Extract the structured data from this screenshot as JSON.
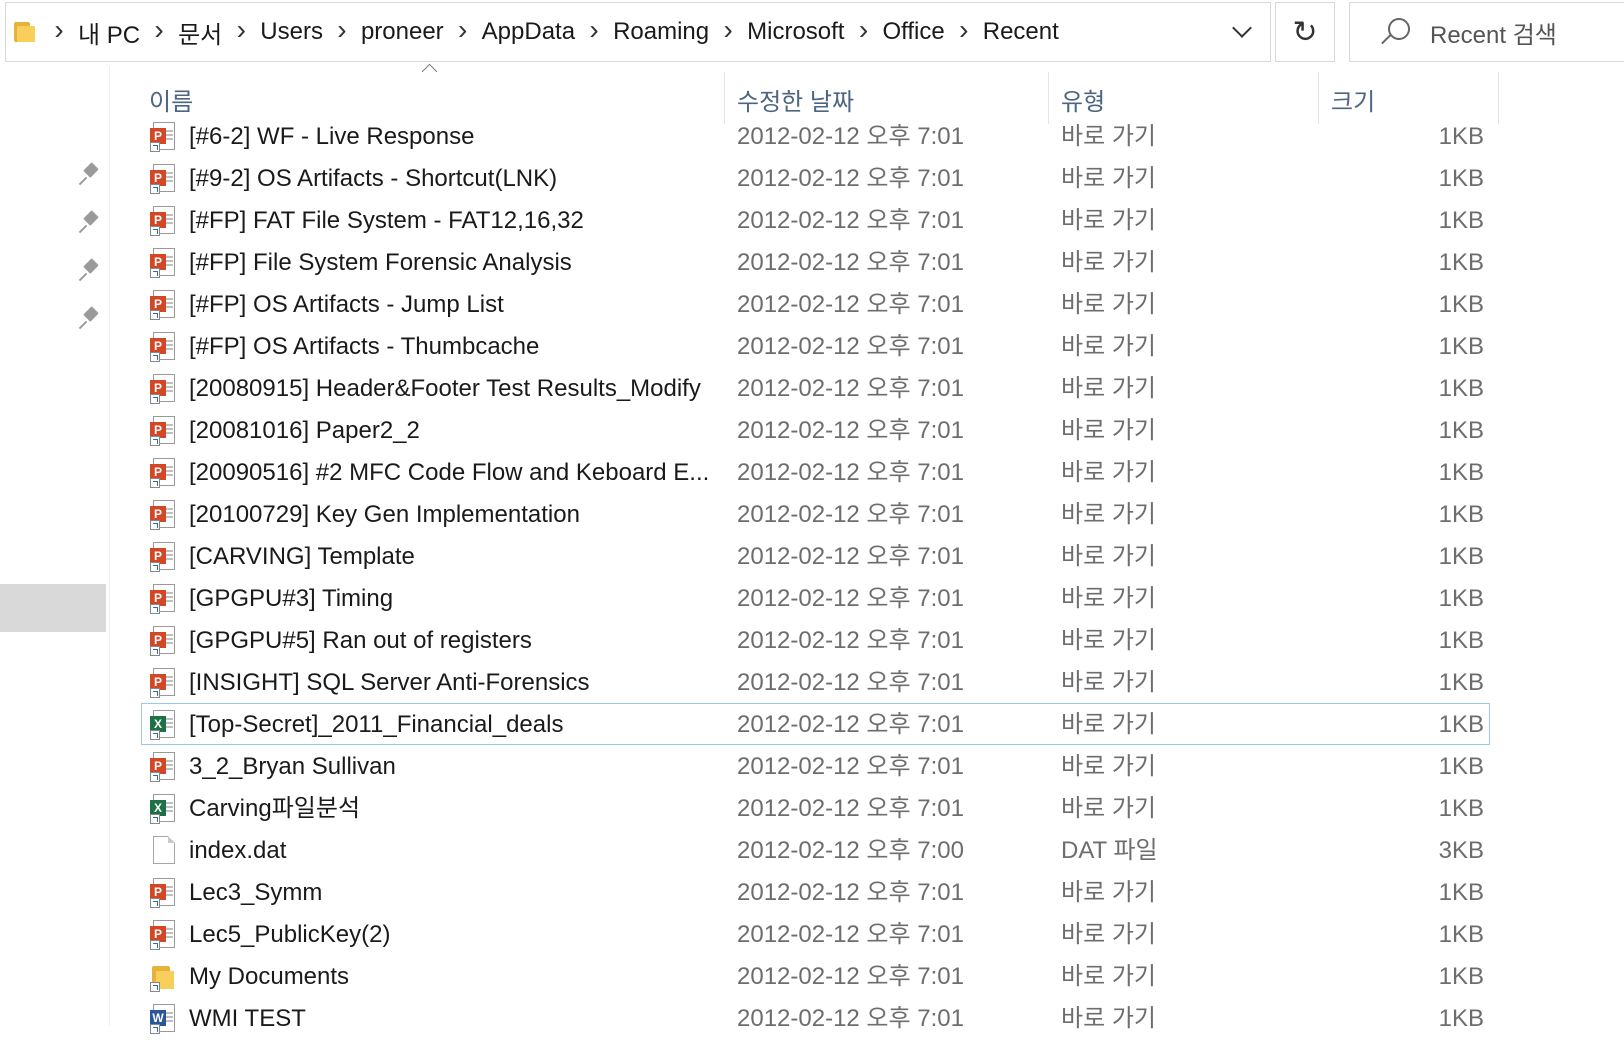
{
  "address_bar": {
    "breadcrumbs": [
      "내 PC",
      "문서",
      "Users",
      "proneer",
      "AppData",
      "Roaming",
      "Microsoft",
      "Office",
      "Recent"
    ]
  },
  "search": {
    "placeholder": "Recent 검색"
  },
  "columns": {
    "name": "이름",
    "date": "수정한 날짜",
    "type": "유형",
    "size": "크기"
  },
  "files": [
    {
      "name": "[#6-2] WF - Live Response",
      "date": "2012-02-12 오후 7:01",
      "type": "바로 가기",
      "size": "1KB",
      "icon": "powerpoint-shortcut-icon"
    },
    {
      "name": "[#9-2] OS Artifacts - Shortcut(LNK)",
      "date": "2012-02-12 오후 7:01",
      "type": "바로 가기",
      "size": "1KB",
      "icon": "powerpoint-shortcut-icon"
    },
    {
      "name": "[#FP] FAT File System - FAT12,16,32",
      "date": "2012-02-12 오후 7:01",
      "type": "바로 가기",
      "size": "1KB",
      "icon": "powerpoint-shortcut-icon"
    },
    {
      "name": "[#FP] File System Forensic Analysis",
      "date": "2012-02-12 오후 7:01",
      "type": "바로 가기",
      "size": "1KB",
      "icon": "powerpoint-shortcut-icon"
    },
    {
      "name": "[#FP] OS Artifacts - Jump List",
      "date": "2012-02-12 오후 7:01",
      "type": "바로 가기",
      "size": "1KB",
      "icon": "powerpoint-shortcut-icon"
    },
    {
      "name": "[#FP] OS Artifacts - Thumbcache",
      "date": "2012-02-12 오후 7:01",
      "type": "바로 가기",
      "size": "1KB",
      "icon": "powerpoint-shortcut-icon"
    },
    {
      "name": "[20080915] Header&Footer Test Results_Modify",
      "date": "2012-02-12 오후 7:01",
      "type": "바로 가기",
      "size": "1KB",
      "icon": "powerpoint-shortcut-icon"
    },
    {
      "name": "[20081016] Paper2_2",
      "date": "2012-02-12 오후 7:01",
      "type": "바로 가기",
      "size": "1KB",
      "icon": "powerpoint-shortcut-icon"
    },
    {
      "name": "[20090516] #2 MFC Code Flow and Keboard E...",
      "date": "2012-02-12 오후 7:01",
      "type": "바로 가기",
      "size": "1KB",
      "icon": "powerpoint-shortcut-icon"
    },
    {
      "name": "[20100729] Key Gen Implementation",
      "date": "2012-02-12 오후 7:01",
      "type": "바로 가기",
      "size": "1KB",
      "icon": "powerpoint-shortcut-icon"
    },
    {
      "name": "[CARVING] Template",
      "date": "2012-02-12 오후 7:01",
      "type": "바로 가기",
      "size": "1KB",
      "icon": "powerpoint-shortcut-icon"
    },
    {
      "name": "[GPGPU#3] Timing",
      "date": "2012-02-12 오후 7:01",
      "type": "바로 가기",
      "size": "1KB",
      "icon": "powerpoint-shortcut-icon"
    },
    {
      "name": "[GPGPU#5] Ran out of registers",
      "date": "2012-02-12 오후 7:01",
      "type": "바로 가기",
      "size": "1KB",
      "icon": "powerpoint-shortcut-icon"
    },
    {
      "name": "[INSIGHT] SQL Server Anti-Forensics",
      "date": "2012-02-12 오후 7:01",
      "type": "바로 가기",
      "size": "1KB",
      "icon": "powerpoint-shortcut-icon"
    },
    {
      "name": "[Top-Secret]_2011_Financial_deals",
      "date": "2012-02-12 오후 7:01",
      "type": "바로 가기",
      "size": "1KB",
      "icon": "excel-shortcut-icon"
    },
    {
      "name": "3_2_Bryan Sullivan",
      "date": "2012-02-12 오후 7:01",
      "type": "바로 가기",
      "size": "1KB",
      "icon": "powerpoint-shortcut-icon"
    },
    {
      "name": "Carving파일분석",
      "date": "2012-02-12 오후 7:01",
      "type": "바로 가기",
      "size": "1KB",
      "icon": "excel-shortcut-icon"
    },
    {
      "name": "index.dat",
      "date": "2012-02-12 오후 7:00",
      "type": "DAT 파일",
      "size": "3KB",
      "icon": "blank-file-icon"
    },
    {
      "name": "Lec3_Symm",
      "date": "2012-02-12 오후 7:01",
      "type": "바로 가기",
      "size": "1KB",
      "icon": "powerpoint-shortcut-icon"
    },
    {
      "name": "Lec5_PublicKey(2)",
      "date": "2012-02-12 오후 7:01",
      "type": "바로 가기",
      "size": "1KB",
      "icon": "powerpoint-shortcut-icon"
    },
    {
      "name": "My Documents",
      "date": "2012-02-12 오후 7:01",
      "type": "바로 가기",
      "size": "1KB",
      "icon": "folder-shortcut-icon"
    },
    {
      "name": "WMI TEST",
      "date": "2012-02-12 오후 7:01",
      "type": "바로 가기",
      "size": "1KB",
      "icon": "word-shortcut-icon"
    }
  ],
  "focused_row": 14,
  "colors": {
    "header_text": "#4d6582",
    "focus_border": "#99c9e8",
    "powerpoint": "#d24726",
    "excel": "#1e7145",
    "word": "#2b579a",
    "folder": "#f7cf5a"
  }
}
